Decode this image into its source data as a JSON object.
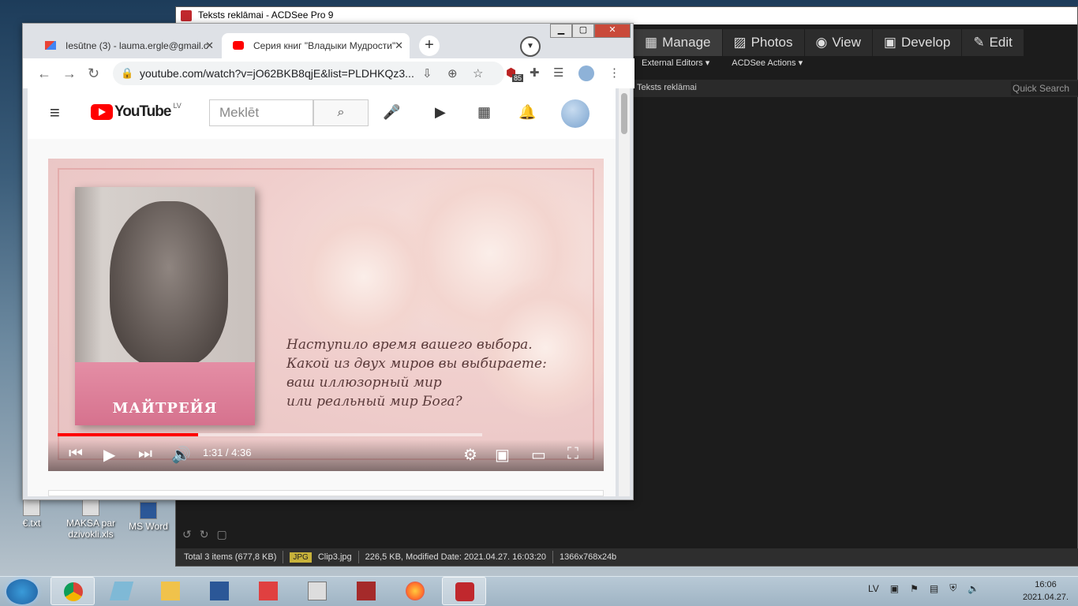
{
  "acdsee": {
    "title": "Teksts reklāmai - ACDSee Pro 9",
    "modes": [
      "Manage",
      "Photos",
      "View",
      "Develop",
      "Edit"
    ],
    "menu": [
      "External Editors ▾",
      "ACDSee Actions ▾"
    ],
    "path": "Teksts reklāmai",
    "quick_search": "Quick Search",
    "status": {
      "total": "Total 3 items  (677,8 KB)",
      "type": "JPG",
      "file": "Clip3.jpg",
      "info": "226,5 KB, Modified Date: 2021.04.27. 16:03:20",
      "dims": "1366x768x24b"
    }
  },
  "desktop": {
    "icons": [
      {
        "label": "€.txt"
      },
      {
        "label": "MAKSA par dzivokli.xls"
      },
      {
        "label": "MS Word"
      }
    ]
  },
  "chrome": {
    "tabs": [
      {
        "title": "Iesūtne (3) - lauma.ergle@gmail.c",
        "favicon": "gmail-icon"
      },
      {
        "title": "Серия книг \"Владыки Мудрости\"",
        "favicon": "youtube-icon",
        "active": true
      }
    ],
    "url": "youtube.com/watch?v=jO62BKB8qjE&list=PLDHKQz3...",
    "ext_badge": "85"
  },
  "youtube": {
    "logo_text": "YouTube",
    "country": "LV",
    "search_placeholder": "Meklēt"
  },
  "video": {
    "book_title": "МАЙТРЕЙЯ",
    "quote_lines": [
      "Наступило время вашего выбора.",
      "Какой из двух миров вы выбираете:",
      "ваш иллюзорный мир",
      "или реальный мир Бога?"
    ],
    "time": "1:31 / 4:36",
    "progress": 0.33
  },
  "taskbar": {
    "lang": "LV",
    "time": "16:06",
    "date": "2021.04.27."
  }
}
